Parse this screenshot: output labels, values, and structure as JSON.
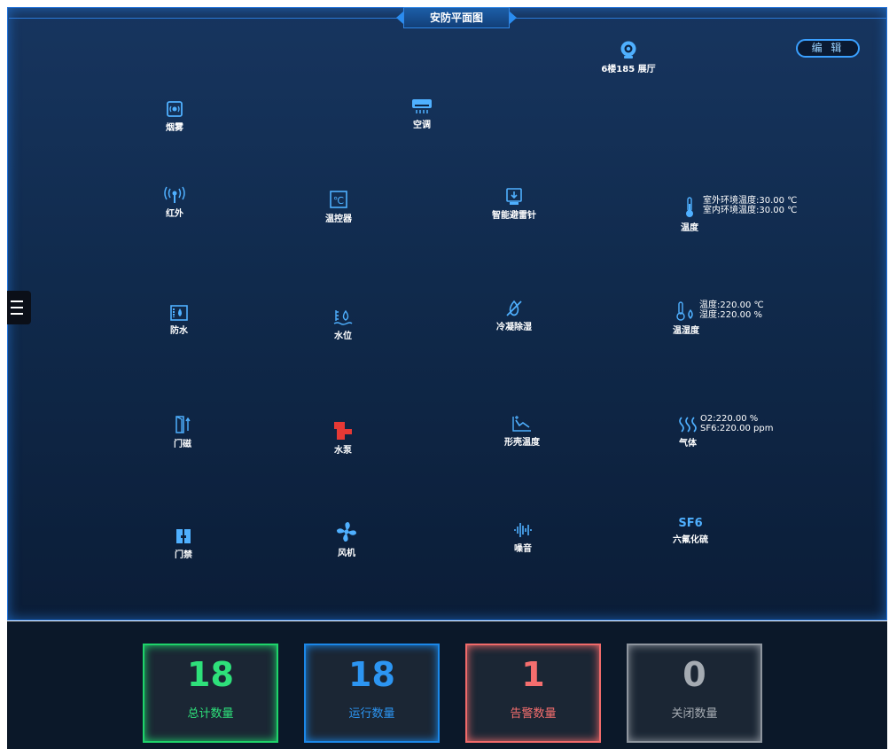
{
  "header": {
    "title": "安防平面图",
    "edit_label": "编 辑"
  },
  "location": {
    "label": "6楼185 展厅"
  },
  "devices": {
    "smoke": "烟雾",
    "ac": "空调",
    "infrared": "红外",
    "thermostat": "温控器",
    "lightning": "智能避雷针",
    "temperature": "温度",
    "waterproof": "防水",
    "water_level": "水位",
    "condensation": "冷凝除湿",
    "humiture": "温湿度",
    "door_magnet": "门磁",
    "pump": "水泵",
    "shell_temp": "形壳温度",
    "gas": "气体",
    "access": "门禁",
    "fan": "风机",
    "noise": "噪音",
    "sf6": "六氟化硫",
    "sf6_icon_text": "SF6"
  },
  "readings": {
    "temperature": [
      "室外环境温度:30.00 ℃",
      "室内环境温度:30.00 ℃"
    ],
    "humiture": [
      "温度:220.00 ℃",
      "湿度:220.00 %"
    ],
    "gas": [
      "O2:220.00 %",
      "SF6:220.00 ppm"
    ]
  },
  "stats": {
    "total": {
      "value": "18",
      "label": "总计数量"
    },
    "running": {
      "value": "18",
      "label": "运行数量"
    },
    "alarm": {
      "value": "1",
      "label": "告警数量"
    },
    "closed": {
      "value": "0",
      "label": "关闭数量"
    }
  },
  "colors": {
    "accent": "#1f6fd6",
    "icon": "#4fb0ff",
    "total": "#2ee07a",
    "running": "#2c95f2",
    "alarm": "#f56e6e",
    "closed": "#a5abb2",
    "pump": "#e53935"
  }
}
